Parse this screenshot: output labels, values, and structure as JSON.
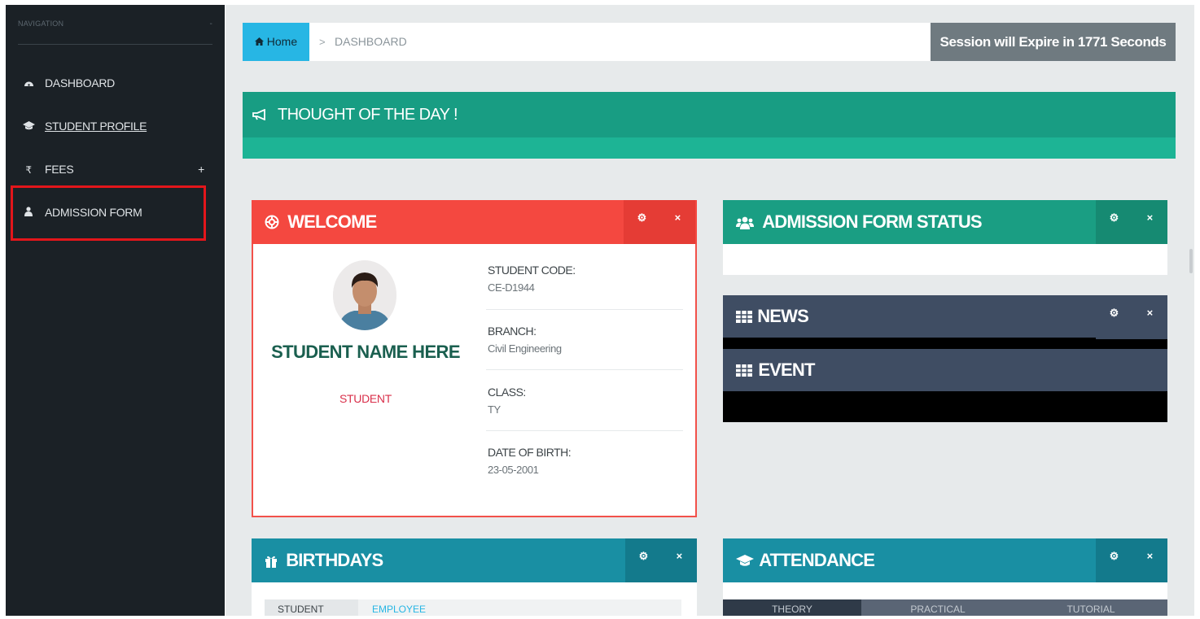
{
  "sidebar": {
    "nav_label": "NAVIGATION",
    "collapse_symbol": "-",
    "items": [
      {
        "label": "DASHBOARD",
        "icon": "dashboard-icon"
      },
      {
        "label": "STUDENT PROFILE",
        "icon": "graduation-cap-icon"
      },
      {
        "label": "FEES",
        "icon": "rupee-icon",
        "expand_symbol": "+"
      },
      {
        "label": "ADMISSION FORM",
        "icon": "user-icon"
      }
    ],
    "highlight_color": "#e3161b"
  },
  "breadcrumb": {
    "home_label": "Home",
    "separator": ">",
    "current": "DASHBOARD"
  },
  "session": {
    "text": "Session will Expire in 1771 Seconds"
  },
  "thought": {
    "title": "THOUGHT OF THE DAY !"
  },
  "welcome": {
    "title": "WELCOME",
    "student_name": "STUDENT NAME HERE",
    "role": "STUDENT",
    "fields": [
      {
        "label": "STUDENT CODE:",
        "value": "CE-D1944"
      },
      {
        "label": "BRANCH:",
        "value": "Civil Engineering"
      },
      {
        "label": "CLASS:",
        "value": "TY"
      },
      {
        "label": "DATE OF BIRTH:",
        "value": "23-05-2001"
      }
    ],
    "accent_color": "#f44840"
  },
  "admission_status": {
    "title": "ADMISSION FORM STATUS"
  },
  "news": {
    "title": "NEWS"
  },
  "event": {
    "title": "EVENT"
  },
  "birthdays": {
    "title": "BIRTHDAYS",
    "tabs": [
      "STUDENT",
      "EMPLOYEE"
    ]
  },
  "attendance": {
    "title": "ATTENDANCE",
    "tabs": [
      "THEORY",
      "PRACTICAL",
      "TUTORIAL"
    ]
  },
  "tool_icons": {
    "settings": "⚙",
    "close": "×"
  }
}
